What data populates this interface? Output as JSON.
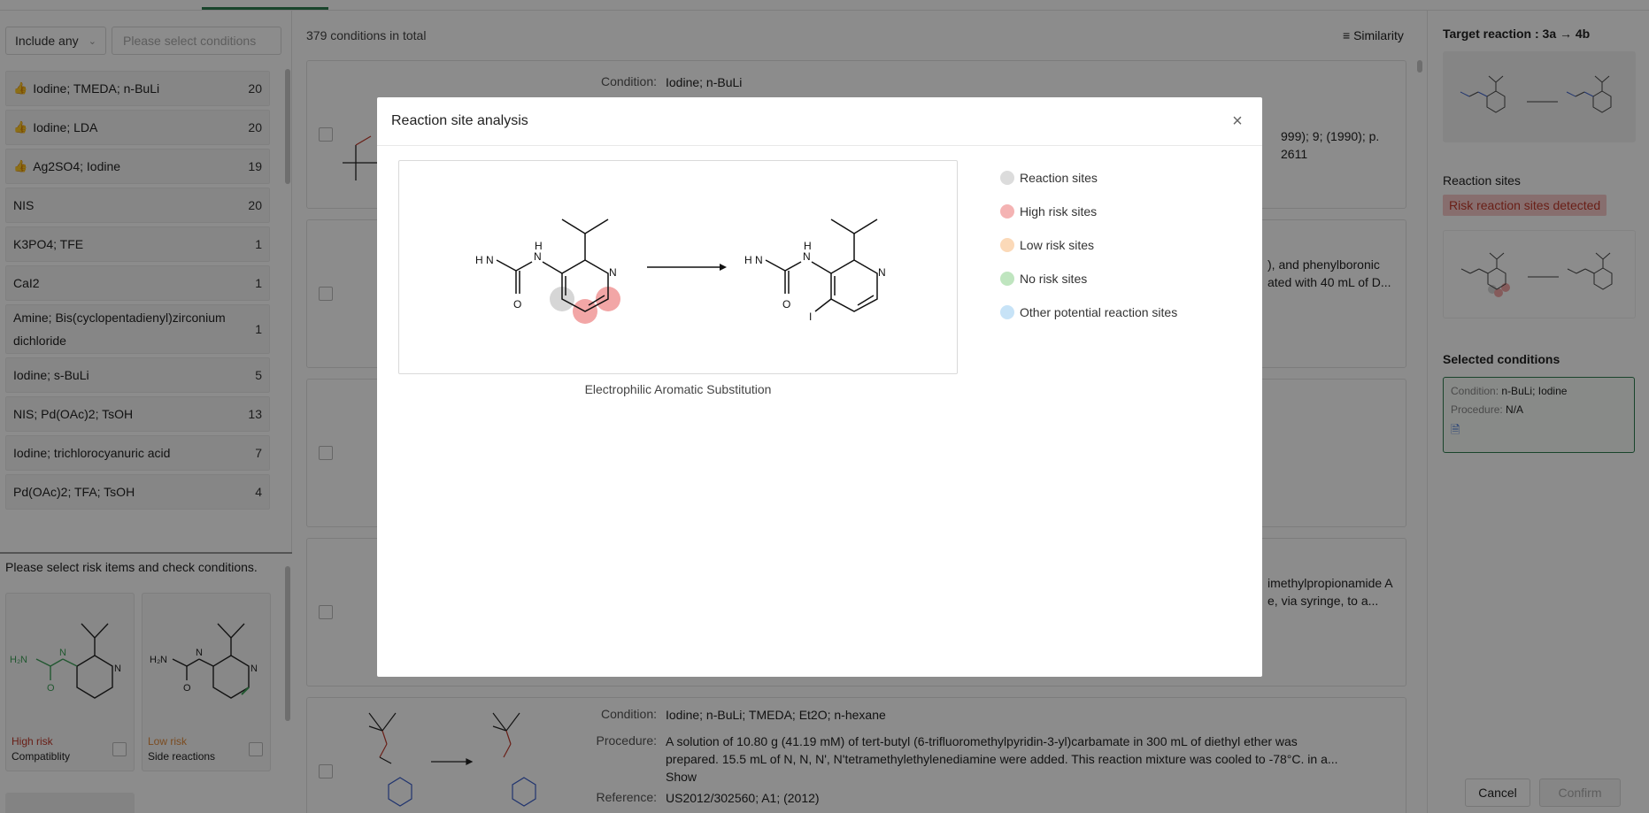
{
  "filter": {
    "mode_label": "Include any",
    "placeholder": "Please select conditions"
  },
  "conditions": [
    {
      "label": "Iodine; TMEDA; n-BuLi",
      "count": "20",
      "recommended": true
    },
    {
      "label": "Iodine; LDA",
      "count": "20",
      "recommended": true
    },
    {
      "label": "Ag2SO4; Iodine",
      "count": "19",
      "recommended": true
    },
    {
      "label": "NIS",
      "count": "20",
      "recommended": false
    },
    {
      "label": "K3PO4; TFE",
      "count": "1",
      "recommended": false
    },
    {
      "label": "CaI2",
      "count": "1",
      "recommended": false
    },
    {
      "label": "Amine; Bis(cyclopentadienyl)zirconium dichloride",
      "count": "1",
      "recommended": false
    },
    {
      "label": "Iodine; s-BuLi",
      "count": "5",
      "recommended": false
    },
    {
      "label": "NIS; Pd(OAc)2; TsOH",
      "count": "13",
      "recommended": false
    },
    {
      "label": "Iodine; trichlorocyanuric acid",
      "count": "7",
      "recommended": false
    },
    {
      "label": "Pd(OAc)2; TFA; TsOH",
      "count": "4",
      "recommended": false
    }
  ],
  "risk": {
    "title": "Please select risk items and check conditions.",
    "cards": [
      {
        "level": "High risk",
        "name": "Compatiblity",
        "color": "#c0392b"
      },
      {
        "level": "Low risk",
        "name": "Side reactions",
        "color": "#e08a3c"
      }
    ]
  },
  "results": {
    "total": "379 conditions in total",
    "sort_label": "Similarity",
    "card1": {
      "condition_label": "Condition:",
      "condition": "Iodine; n-BuLi",
      "ref_tail": "999); 9; (1990); p. 2611"
    },
    "card2": {
      "text1": "), and phenylboronic",
      "text2": "ated with 40 mL of D..."
    },
    "card4": {
      "text1": "imethylpropionamide A",
      "text2": "e, via syringe, to a..."
    },
    "card5": {
      "condition_label": "Condition:",
      "condition": "Iodine; n-BuLi; TMEDA; Et2O; n-hexane",
      "procedure_label": "Procedure:",
      "procedure1": "A solution of 10.80 g (41.19 mM) of tert-butyl (6-trifluoromethylpyridin-3-yl)carbamate in 300 mL of diethyl ether was",
      "procedure2": "prepared. 15.5 mL of N, N, N', N'tetramethylethylenediamine were added. This reaction mixture was cooled to -78°C. in a...",
      "show": "Show",
      "reference_label": "Reference:",
      "reference": "US2012/302560; A1; (2012)"
    }
  },
  "right": {
    "target_title": "Target reaction : 3a → 4b",
    "sites_title": "Reaction sites",
    "risk_tag": "Risk reaction sites detected",
    "selected_title": "Selected conditions",
    "sel_condition_label": "Condition:",
    "sel_condition": "n-BuLi; Iodine",
    "sel_procedure_label": "Procedure:",
    "sel_procedure": "N/A",
    "cancel": "Cancel",
    "confirm": "Confirm"
  },
  "modal": {
    "title": "Reaction site analysis",
    "caption": "Electrophilic Aromatic Substitution",
    "legend": [
      {
        "label": "Reaction sites",
        "color": "#dcdcdc"
      },
      {
        "label": "High risk sites",
        "color": "#f4b3b3"
      },
      {
        "label": "Low risk sites",
        "color": "#fbd9b8"
      },
      {
        "label": "No risk sites",
        "color": "#bfe5bf"
      },
      {
        "label": "Other potential reaction sites",
        "color": "#c7e3f7"
      }
    ],
    "site_colors": {
      "reaction": "#d6d6d6",
      "high": "#f2a6a6"
    }
  },
  "chem": {
    "h2n": "H",
    "n": "N",
    "o": "O",
    "i": "I"
  }
}
